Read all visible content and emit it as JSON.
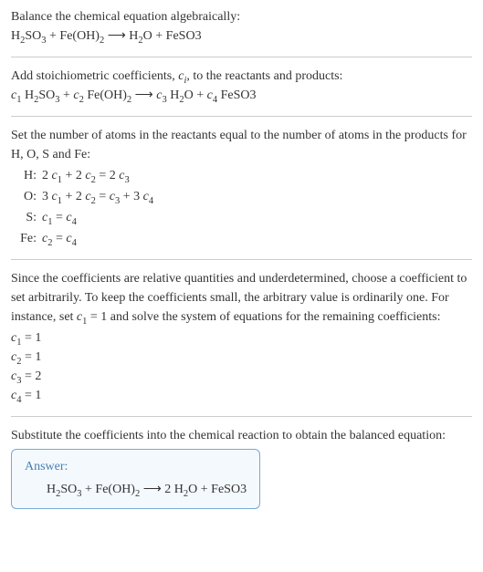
{
  "intro": "Balance the chemical equation algebraically:",
  "equation1": "H_{2}SO_{3} + Fe(OH)_{2} \\longrightarrow H_{2}O + FeSO3",
  "step_add_coeff_label": "Add stoichiometric coefficients, ",
  "step_add_coeff_var": "c_{i}",
  "step_add_coeff_rest": ", to the reactants and products:",
  "equation2": "c_{1} H_{2}SO_{3} + c_{2} Fe(OH)_{2} \\longrightarrow c_{3} H_{2}O + c_{4} FeSO3",
  "step_set_atoms": "Set the number of atoms in the reactants equal to the number of atoms in the products for H, O, S and Fe:",
  "atoms": [
    {
      "label": "H:",
      "eq": "2 c_{1} + 2 c_{2} = 2 c_{3}"
    },
    {
      "label": "O:",
      "eq": "3 c_{1} + 2 c_{2} = c_{3} + 3 c_{4}"
    },
    {
      "label": "S:",
      "eq": "c_{1} = c_{4}"
    },
    {
      "label": "Fe:",
      "eq": "c_{2} = c_{4}"
    }
  ],
  "step_arbitrary_a": "Since the coefficients are relative quantities and underdetermined, choose a coefficient to set arbitrarily. To keep the coefficients small, the arbitrary value is ordinarily one. For instance, set ",
  "step_arbitrary_c": "c_{1} = 1",
  "step_arbitrary_b": " and solve the system of equations for the remaining coefficients:",
  "coeffs": [
    "c_{1} = 1",
    "c_{2} = 1",
    "c_{3} = 2",
    "c_{4} = 1"
  ],
  "step_subst": "Substitute the coefficients into the chemical reaction to obtain the balanced equation:",
  "answer_label": "Answer:",
  "answer_eq": "H_{2}SO_{3} + Fe(OH)_{2} \\longrightarrow 2 H_{2}O + FeSO3"
}
